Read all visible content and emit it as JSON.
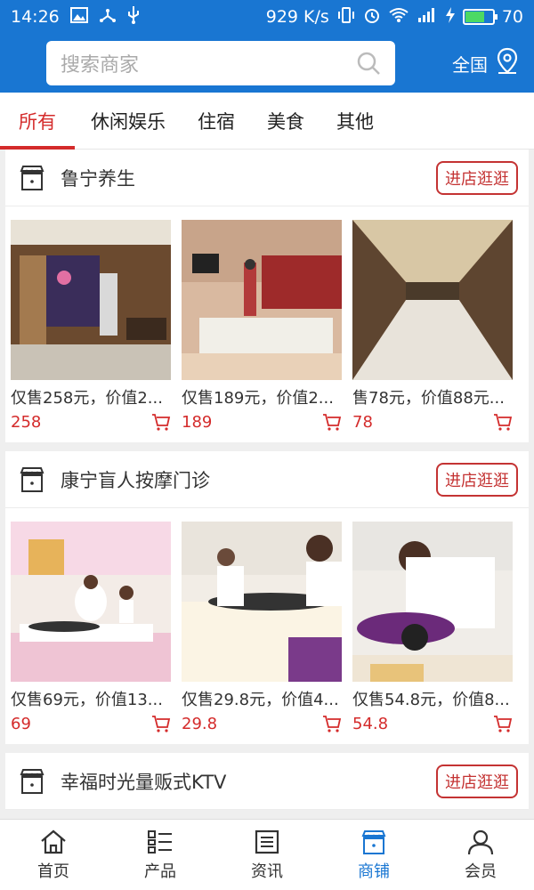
{
  "status_bar": {
    "time": "14:26",
    "network_speed": "929 K/s",
    "battery_level": "70"
  },
  "header": {
    "search_placeholder": "搜索商家",
    "region_label": "全国"
  },
  "tabs": [
    {
      "label": "所有",
      "active": true
    },
    {
      "label": "休闲娱乐",
      "active": false
    },
    {
      "label": "住宿",
      "active": false
    },
    {
      "label": "美食",
      "active": false
    },
    {
      "label": "其他",
      "active": false
    }
  ],
  "stores": [
    {
      "name": "鲁宁养生",
      "visit_label": "进店逛逛",
      "products": [
        {
          "desc": "仅售258元，价值2...",
          "price": "258"
        },
        {
          "desc": "仅售189元，价值2...",
          "price": "189"
        },
        {
          "desc": "售78元，价值88元...",
          "price": "78"
        }
      ]
    },
    {
      "name": "康宁盲人按摩门诊",
      "visit_label": "进店逛逛",
      "products": [
        {
          "desc": "仅售69元，价值13...",
          "price": "69"
        },
        {
          "desc": "仅售29.8元，价值4...",
          "price": "29.8"
        },
        {
          "desc": "仅售54.8元，价值8...",
          "price": "54.8"
        }
      ]
    },
    {
      "name": "幸福时光量贩式KTV",
      "visit_label": "进店逛逛",
      "products": []
    }
  ],
  "bottom_nav": [
    {
      "label": "首页",
      "icon": "home-icon",
      "active": false
    },
    {
      "label": "产品",
      "icon": "list-icon",
      "active": false
    },
    {
      "label": "资讯",
      "icon": "news-icon",
      "active": false
    },
    {
      "label": "商铺",
      "icon": "shop-icon",
      "active": true
    },
    {
      "label": "会员",
      "icon": "user-icon",
      "active": false
    }
  ],
  "colors": {
    "primary": "#1976d2",
    "accent_red": "#d42b2b"
  }
}
